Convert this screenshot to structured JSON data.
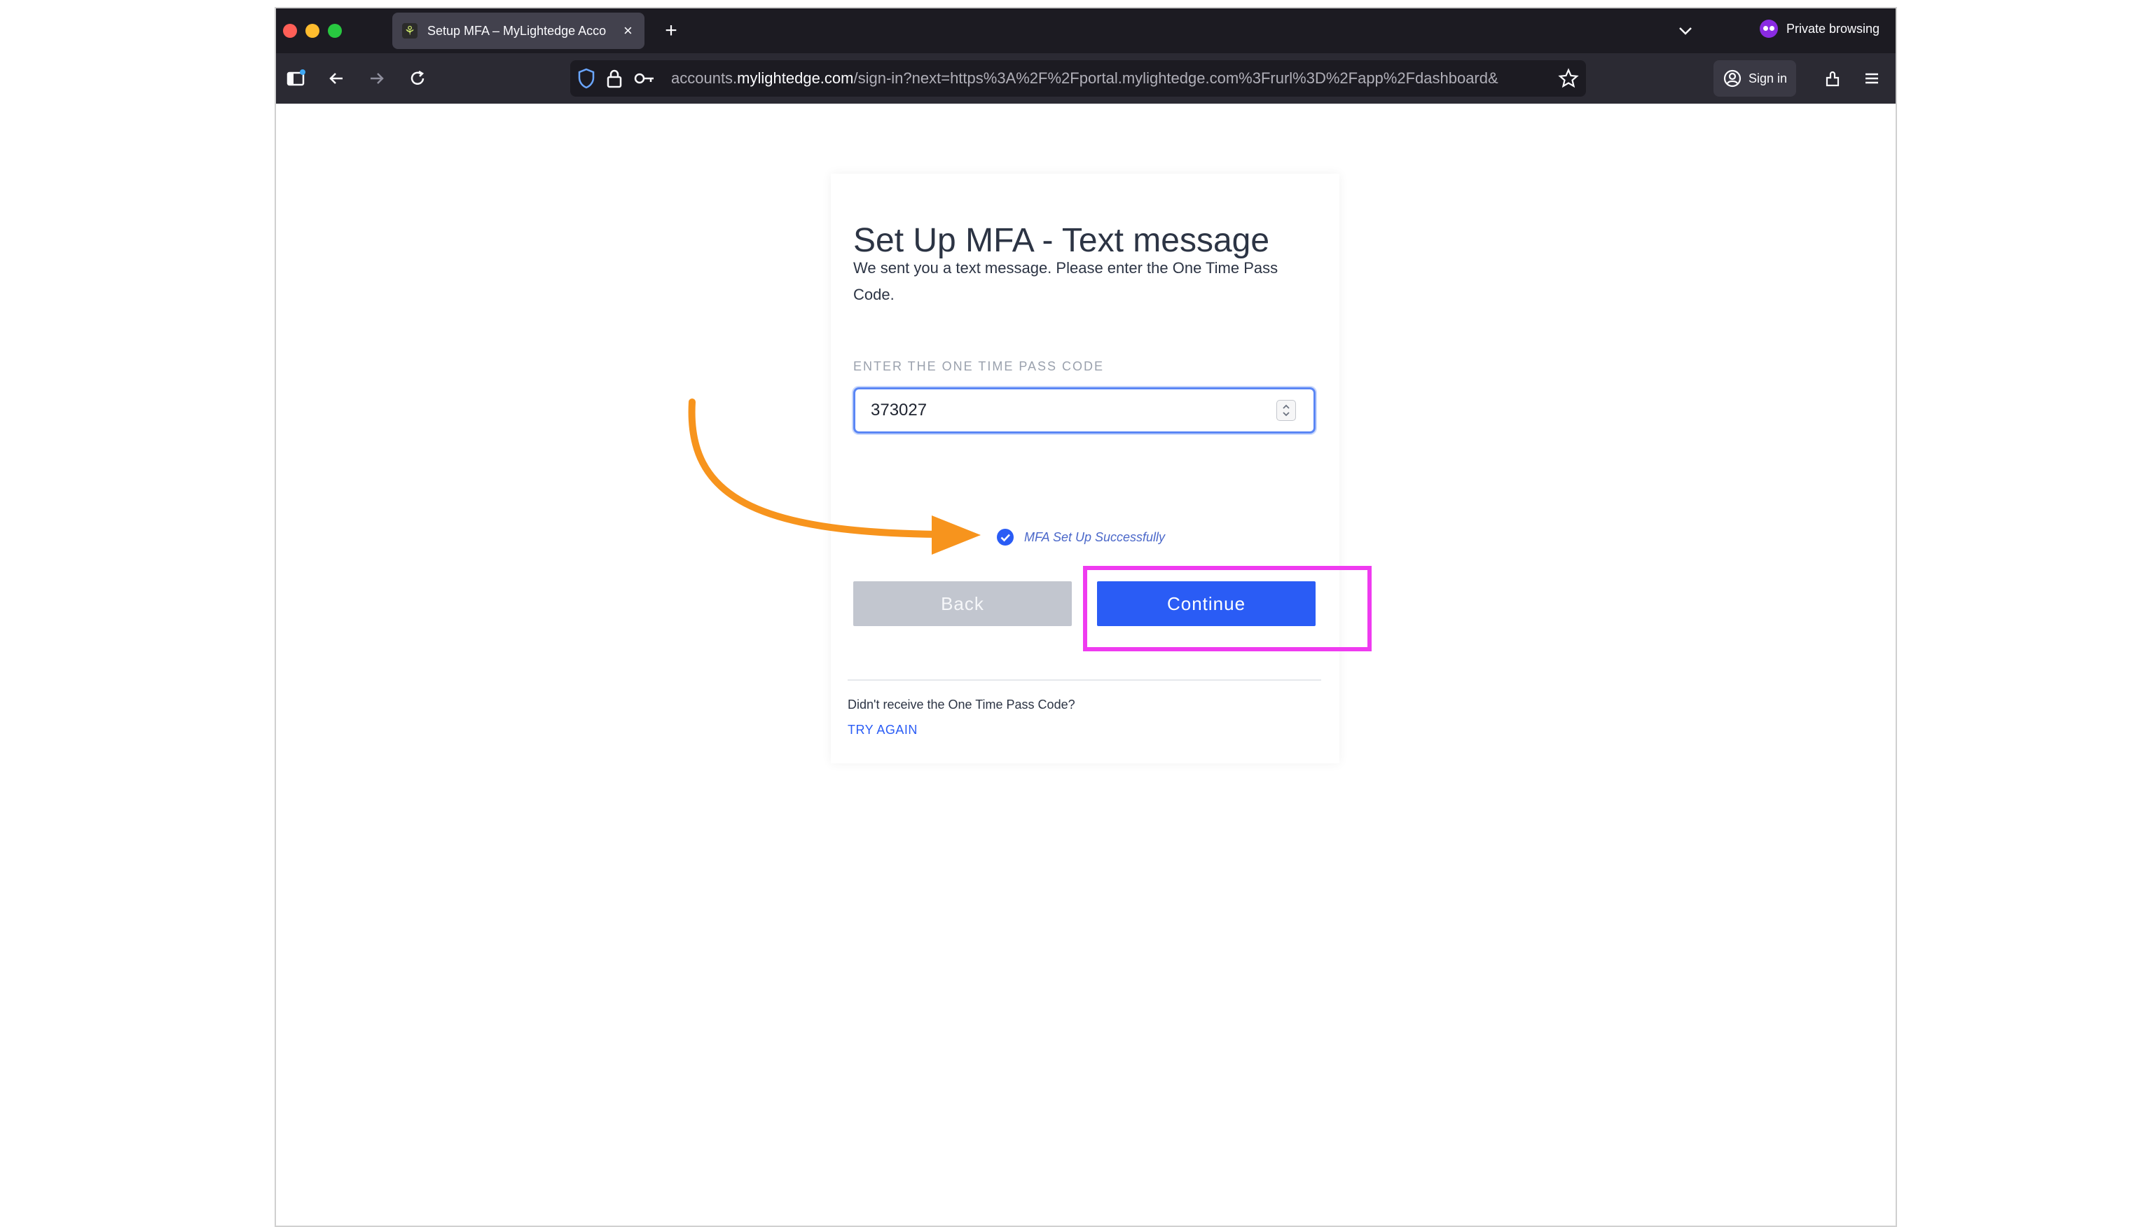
{
  "browser": {
    "tab_title": "Setup MFA – MyLightedge Acco",
    "tab_favicon_glyph": "⚘",
    "new_tab_label": "+",
    "close_tab_label": "×",
    "private_label": "Private browsing",
    "url_prefix": "accounts.",
    "url_domain": "mylightedge.com",
    "url_path": "/sign-in?next=https%3A%2F%2Fportal.mylightedge.com%3Frurl%3D%2Fapp%2Fdashboard&",
    "signin_label": "Sign in"
  },
  "icons": {
    "sidebar": "sidebar-icon",
    "back": "arrow-left-icon",
    "forward": "arrow-right-icon",
    "reload": "reload-icon",
    "shield": "shield-icon",
    "lock": "lock-icon",
    "key": "key-icon",
    "star": "star-icon",
    "account": "account-icon",
    "extensions": "extensions-icon",
    "menu": "hamburger-menu-icon",
    "check": "check-circle-icon"
  },
  "page": {
    "title": "Set Up MFA - Text message",
    "subtitle": "We sent you a text message. Please enter the One Time Pass Code.",
    "field_label": "ENTER THE ONE TIME PASS CODE",
    "otp_value": "373027",
    "success_message": "MFA Set Up Successfully",
    "back_label": "Back",
    "continue_label": "Continue",
    "resend_prompt": "Didn't receive the One Time Pass Code?",
    "try_again_label": "TRY AGAIN"
  },
  "colors": {
    "primary_blue": "#2a5cf5",
    "disabled_gray": "#c2c6cf",
    "annotation_orange": "#f7941d",
    "annotation_magenta": "#ef3bf0"
  }
}
